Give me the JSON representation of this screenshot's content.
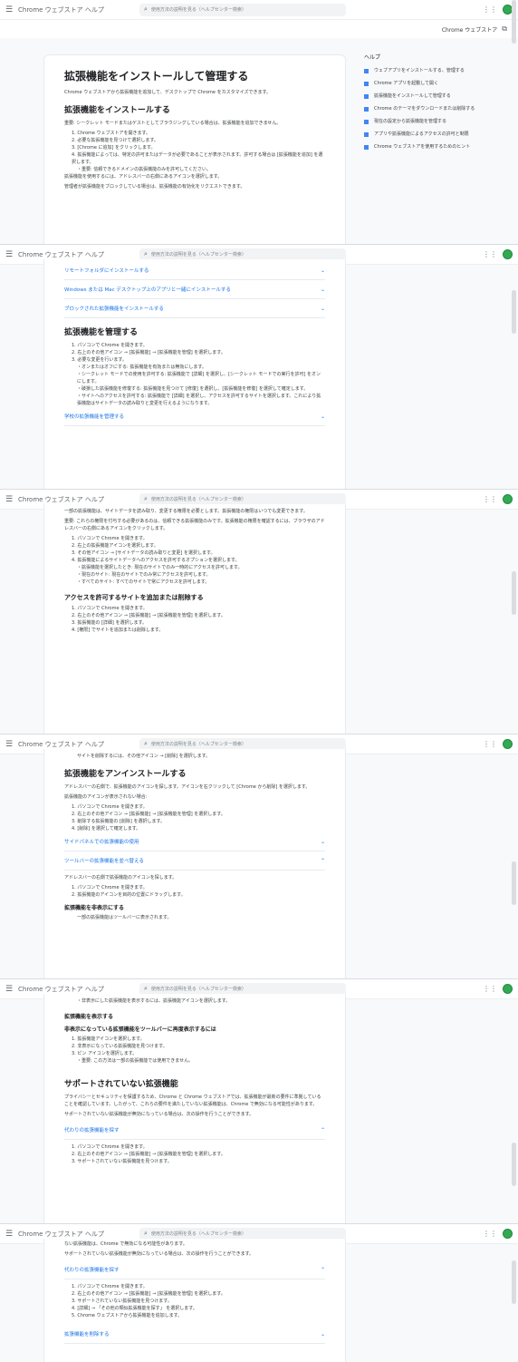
{
  "app": {
    "title": "Chrome ウェブストア ヘルプ",
    "search_placeholder": "使用方法の説明を見る（ヘルプセンター検索）",
    "breadcrumb": "Chrome ウェブストア"
  },
  "sidebar": {
    "title": "ヘルプ",
    "items": [
      "ウェブアプリをインストールする、管理する",
      "Chrome アプリを起動して開く",
      "拡張機能をインストールして管理する",
      "Chrome のテーマをダウンロードまたは削除する",
      "現在の設定から拡張機能を管理する",
      "アプリや拡張機能によるアクセスの許可と制限",
      "Chrome ウェブストアを使用するためのヒント"
    ]
  },
  "f1": {
    "h1": "拡張機能をインストールして管理する",
    "intro": "Chrome ウェブストアから拡張機能を追加して、デスクトップで Chrome をカスタマイズできます。",
    "h2": "拡張機能をインストールする",
    "note": "重要: シークレット モードまたはゲストとしてブラウジングしている場合は、拡張機能を追加できません。",
    "steps": [
      "1. Chrome ウェブストアを開きます。",
      "2. 必要な拡張機能を見つけて選択します。",
      "3. [Chrome に追加] をクリックします。",
      "4. 拡張機能によっては、特定の許可またはデータが必要であることが表示されます。許可する場合は [拡張機能を追加] を選択します。",
      "・重要: 信頼できるドメインの拡張機能のみを許可してください。"
    ],
    "after": "拡張機能を使用するには、アドレスバーの右側にあるアイコンを選択します。",
    "after2": "管理者が拡張機能をブロックしている場合は、拡張機能の有効化をリクエストできます。"
  },
  "f2": {
    "exp1": "リモートフォルダにインストールする",
    "exp2": "Windows または Mac デスクトップ上のアプリと一緒にインストールする",
    "exp3": "ブロックされた拡張機能をインストールする",
    "h2": "拡張機能を管理する",
    "steps": [
      "1. パソコンで Chrome を開きます。",
      "2. 右上のその他アイコン → [拡張機能] → [拡張機能を管理] を選択します。",
      "3. 必要な変更を行います。"
    ],
    "subs": [
      "・オンまたはオフにする: 拡張機能を有効または無効にします。",
      "・シークレット モードでの使用を許可する: 拡張機能で [詳細] を選択し、[シークレット モードでの実行を許可] をオンにします。",
      "・破損した拡張機能を修復する: 拡張機能を見つけて [修復] を選択し、[拡張機能を修復] を選択して確定します。",
      "・サイトへのアクセスを許可する: 拡張機能で [詳細] を選択し、アクセスを許可するサイトを選択します。これにより拡張機能はサイトデータの読み取りと変更を行えるようになります。"
    ],
    "exp4": "学校の拡張機能を管理する"
  },
  "f3": {
    "p1": "一部の拡張機能は、サイトデータを読み取り、変更する権限を必要とします。拡張機能の権限はいつでも変更できます。",
    "p2": "重要: これらの権限を付与する必要があるのは、信頼できる拡張機能のみです。拡張機能の権限を確認するには、ブラウザのアドレスバーの右側にあるアイコンをクリックします。",
    "steps": [
      "1. パソコンで Chrome を開きます。",
      "2. 右上の拡張機能アイコンを選択します。",
      "3. その他アイコン → [サイトデータの読み取りと変更] を選択します。",
      "4. 拡張機能によるサイトデータへのアクセスを許可するオプションを選択します。"
    ],
    "subs": [
      "・拡張機能を選択したとき: 現在のサイトでのみ一時的にアクセスを許可します。",
      "・現在のサイト: 現在のサイトでのみ常にアクセスを許可します。",
      "・すべてのサイト: すべてのサイトで常にアクセスを許可します。"
    ],
    "h3": "アクセスを許可するサイトを追加または削除する",
    "steps2": [
      "1. パソコンで Chrome を開きます。",
      "2. 右上のその他アイコン → [拡張機能] → [拡張機能を管理] を選択します。",
      "3. 拡張機能の [詳細] を選択します。",
      "4. [権限] でサイトを追加または削除します。"
    ]
  },
  "f4": {
    "top": "サイトを削除するには、その他アイコン → [削除] を選択します。",
    "h2": "拡張機能をアンインストールする",
    "p1": "アドレスバーの右側で、拡張機能のアイコンを探します。アイコンを右クリックして [Chrome から削除] を選択します。",
    "p2": "拡張機能のアイコンが表示されない場合:",
    "steps": [
      "1. パソコンで Chrome を開きます。",
      "2. 右上のその他アイコン → [拡張機能] → [拡張機能を管理] を選択します。",
      "3. 削除する拡張機能の [削除] を選択します。",
      "4. [削除] を選択して確定します。"
    ],
    "exp1": "サイドパネルでの拡張機能の使用",
    "exp2": "ツールバーの拡張機能を並べ替える",
    "p3": "アドレスバーの右側で拡張機能のアイコンを探します。",
    "steps2": [
      "1. パソコンで Chrome を開きます。",
      "2. 拡張機能のアイコンを目的の位置にドラッグします。"
    ],
    "h3": "拡張機能を非表示にする",
    "sub": "一部の拡張機能はツールバーに表示されます。"
  },
  "f5": {
    "top": "・非表示にした拡張機能を表示するには、拡張機能アイコンを選択します。",
    "h3a": "拡張機能を表示する",
    "h3b": "非表示になっている拡張機能をツールバーに再度表示するには",
    "steps": [
      "1. 拡張機能アイコンを選択します。",
      "2. 非表示になっている拡張機能を見つけます。",
      "3. ピン アイコンを選択します。"
    ],
    "sub": "・重要: この方法は一部の拡張機能では使用できません。",
    "h2": "サポートされていない拡張機能",
    "p1": "プライバシーとセキュリティを保護するため、Chrome と Chrome ウェブストアでは、拡張機能が最新の要件に準拠していることを確認しています。したがって、これらの要件を満たしていない拡張機能は、Chrome で無効になる可能性があります。",
    "p2": "サポートされていない拡張機能が無効になっている場合は、次の操作を行うことができます。",
    "exp1": "代わりの拡張機能を探す",
    "steps2": [
      "1. パソコンで Chrome を開きます。",
      "2. 右上のその他アイコン → [拡張機能] → [拡張機能を管理] を選択します。",
      "3. サポートされていない拡張機能を見つけます。"
    ]
  },
  "f6": {
    "top1": "ない拡張機能は、Chrome で無効になる可能性があります。",
    "top2": "サポートされていない拡張機能が無効になっている場合は、次の操作を行うことができます。",
    "exp1": "代わりの拡張機能を探す",
    "steps": [
      "1. パソコンで Chrome を開きます。",
      "2. 右上のその他アイコン → [拡張機能] → [拡張機能を管理] を選択します。",
      "3. サポートされていない拡張機能を見つけます。",
      "4. [詳細] → 「その他の類似拡張機能を探す」 を選択します。",
      "5. Chrome ウェブストアから拡張機能を追加します。"
    ],
    "exp2": "拡張機能を削除する"
  }
}
